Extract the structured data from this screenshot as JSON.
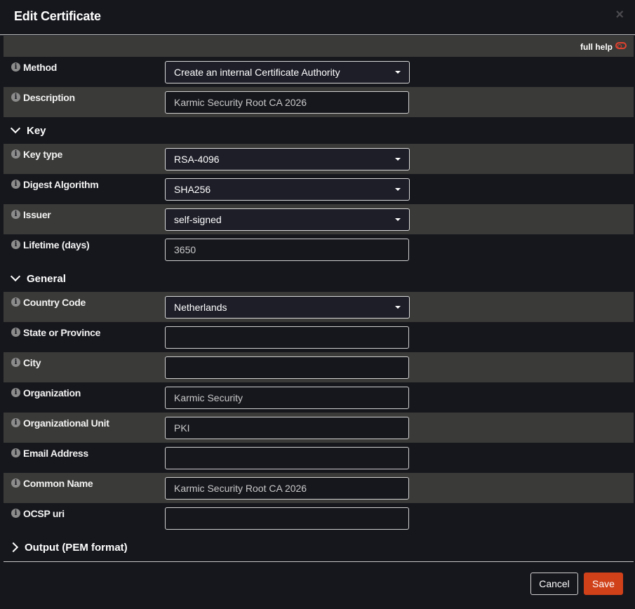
{
  "dialog": {
    "title": "Edit Certificate",
    "close_glyph": "×"
  },
  "help": {
    "label": "full help",
    "enabled": false,
    "toggle_color": "#e2422f"
  },
  "fields": {
    "method": {
      "label": "Method",
      "value": "Create an internal Certificate Authority"
    },
    "description": {
      "label": "Description",
      "value": "Karmic Security Root CA 2026",
      "placeholder": ""
    }
  },
  "sections": {
    "key": {
      "title": "Key",
      "expanded": true
    },
    "general": {
      "title": "General",
      "expanded": true
    },
    "output": {
      "title": "Output (PEM format)",
      "expanded": false
    }
  },
  "key": {
    "key_type": {
      "label": "Key type",
      "value": "RSA-4096"
    },
    "digest": {
      "label": "Digest Algorithm",
      "value": "SHA256"
    },
    "issuer": {
      "label": "Issuer",
      "value": "self-signed"
    },
    "lifetime": {
      "label": "Lifetime (days)",
      "value": "3650"
    }
  },
  "general": {
    "country": {
      "label": "Country Code",
      "value": "Netherlands"
    },
    "state": {
      "label": "State or Province",
      "value": ""
    },
    "city": {
      "label": "City",
      "value": ""
    },
    "organization": {
      "label": "Organization",
      "value": "Karmic Security"
    },
    "org_unit": {
      "label": "Organizational Unit",
      "value": "PKI"
    },
    "email": {
      "label": "Email Address",
      "value": ""
    },
    "common_name": {
      "label": "Common Name",
      "value": "Karmic Security Root CA 2026"
    },
    "ocsp": {
      "label": "OCSP uri",
      "value": ""
    }
  },
  "footer": {
    "cancel_label": "Cancel",
    "save_label": "Save",
    "save_color": "#d0411a"
  },
  "icons": {
    "info": "info-circle-icon",
    "chevron_down": "chevron-down-icon",
    "chevron_right": "chevron-right-icon",
    "caret": "caret-down-icon"
  }
}
